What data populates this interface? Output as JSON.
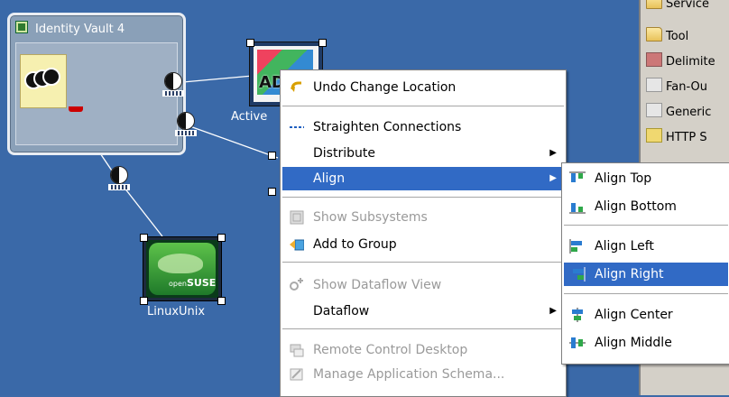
{
  "canvas": {
    "vault": {
      "title": "Identity Vault 4"
    },
    "active_node": {
      "label": "Active",
      "logo_text": "AD"
    },
    "linux_node": {
      "label": "LinuxUnix",
      "brand_small": "open",
      "brand": "SUSE"
    }
  },
  "palette": {
    "items": [
      {
        "label": "Service",
        "icon": "folder-icon"
      },
      {
        "label": "Tool",
        "icon": "folder-icon"
      },
      {
        "label": "Delimite",
        "icon": "text-icon"
      },
      {
        "label": "Fan-Ou",
        "icon": "gray-icon"
      },
      {
        "label": "Generic",
        "icon": "gray-icon"
      },
      {
        "label": "HTTP S",
        "icon": "http-icon"
      }
    ]
  },
  "context_menu": {
    "items": [
      {
        "label": "Undo Change Location",
        "enabled": true,
        "icon": "undo-icon"
      },
      {
        "label": "Straighten Connections",
        "enabled": true,
        "icon": "straighten-icon"
      },
      {
        "label": "Distribute",
        "enabled": true,
        "submenu": true
      },
      {
        "label": "Align",
        "enabled": true,
        "submenu": true,
        "highlighted": true
      },
      {
        "label": "Show Subsystems",
        "enabled": false,
        "icon": "subsystems-icon"
      },
      {
        "label": "Add to Group",
        "enabled": true,
        "icon": "add-to-group-icon"
      },
      {
        "label": "Show Dataflow View",
        "enabled": false,
        "icon": "dataflow-icon"
      },
      {
        "label": "Dataflow",
        "enabled": true,
        "submenu": true
      },
      {
        "label": "Remote Control Desktop",
        "enabled": false,
        "icon": "remote-desktop-icon"
      },
      {
        "label": "Manage Application Schema...",
        "enabled": false,
        "icon": "schema-icon"
      }
    ]
  },
  "align_submenu": {
    "items": [
      {
        "label": "Align Top",
        "icon": "align-top-icon"
      },
      {
        "label": "Align Bottom",
        "icon": "align-bottom-icon"
      },
      {
        "label": "Align Left",
        "icon": "align-left-icon"
      },
      {
        "label": "Align Right",
        "icon": "align-right-icon",
        "highlighted": true
      },
      {
        "label": "Align Center",
        "icon": "align-center-icon"
      },
      {
        "label": "Align Middle",
        "icon": "align-middle-icon"
      }
    ]
  },
  "colors": {
    "canvas_bg": "#3a69a8",
    "menu_highlight": "#316ac5",
    "disabled_text": "#9a9a9a"
  }
}
